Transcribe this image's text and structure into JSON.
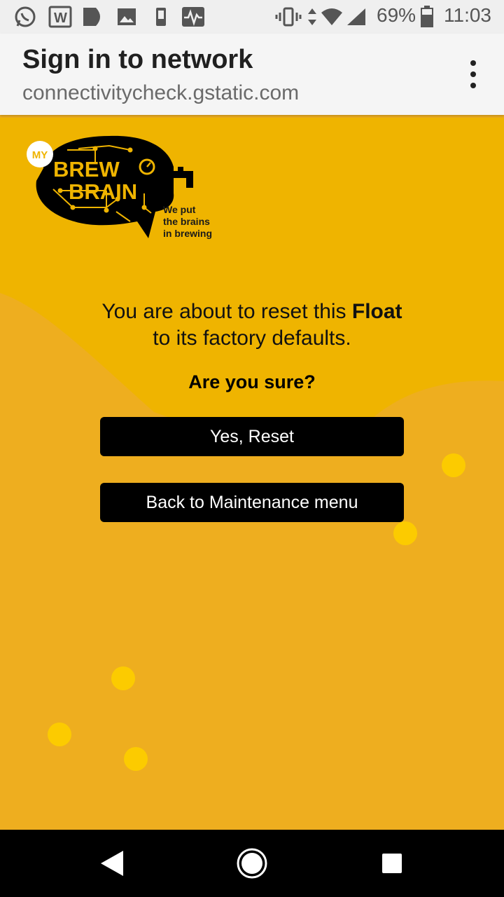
{
  "status_bar": {
    "battery_percent": "69%",
    "time": "11:03",
    "left_icons": [
      "whatsapp-icon",
      "word-icon",
      "play-icon",
      "image-icon",
      "phone-device-icon",
      "activity-icon"
    ],
    "right_icons": [
      "vibrate-icon",
      "data-arrows-icon",
      "wifi-icon",
      "signal-icon",
      "battery-icon"
    ]
  },
  "app_bar": {
    "title": "Sign in to network",
    "subtitle": "connectivitycheck.gstatic.com",
    "menu_icon": "more-vert-icon"
  },
  "logo": {
    "badge": "MY",
    "line1": "BREW",
    "line2": "BRAIN",
    "tagline1": "We put",
    "tagline2": "the brains",
    "tagline3": "in brewing"
  },
  "message": {
    "line1_prefix": "You are about to reset this ",
    "line1_bold": "Float",
    "line2": "to its factory defaults.",
    "question": "Are you sure?"
  },
  "buttons": {
    "reset_label": "Yes, Reset",
    "back_label": "Back to Maintenance menu"
  },
  "colors": {
    "accent_yellow": "#EFB400",
    "background_yellow": "#EEAE1F",
    "bubble_yellow": "#FCCB00",
    "button_black": "#000000"
  },
  "nav_bar": {
    "icons": [
      "back-icon",
      "home-icon",
      "recents-icon"
    ]
  }
}
